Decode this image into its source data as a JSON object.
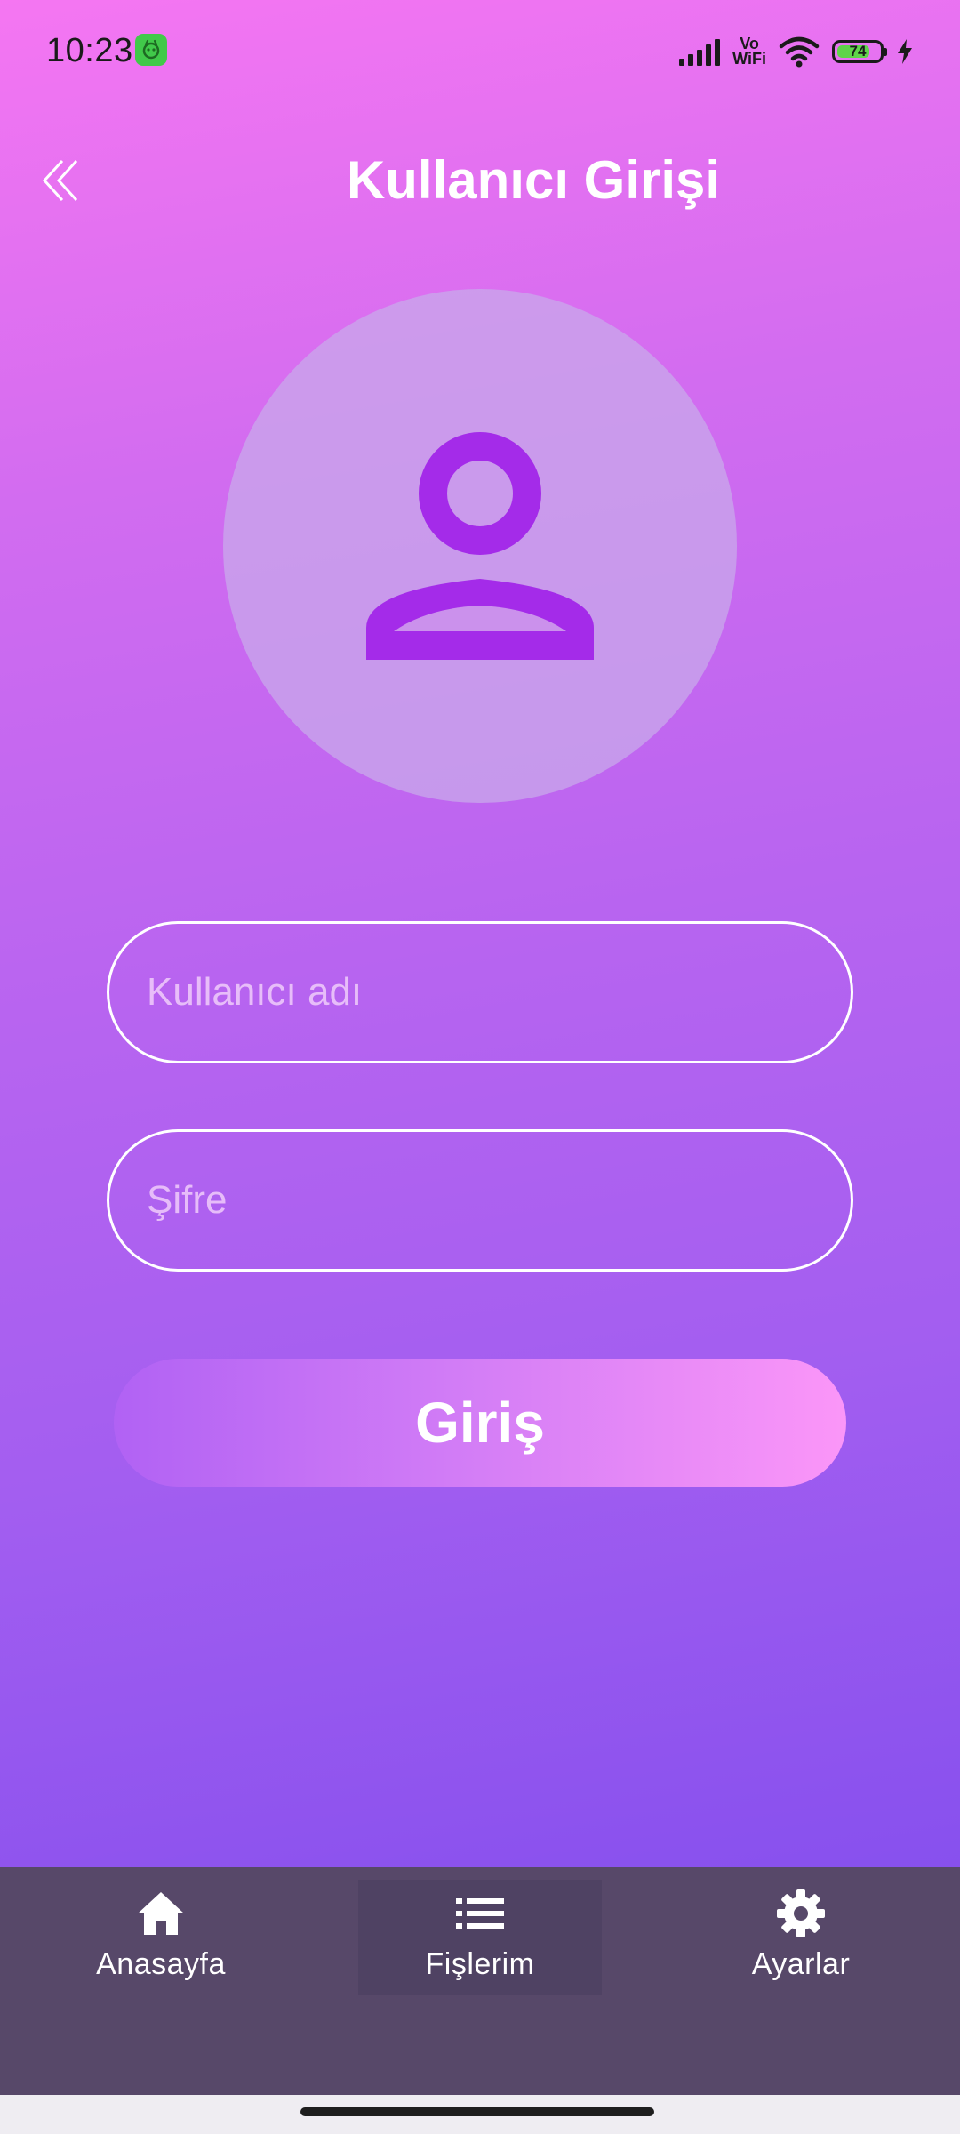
{
  "status_bar": {
    "time": "10:23",
    "network_label_top": "Vo",
    "network_label_bottom": "WiFi",
    "battery_level": "74",
    "icons": [
      "app-notification-icon",
      "signal-icon",
      "vowifi-icon",
      "wifi-icon",
      "battery-icon",
      "charging-icon"
    ]
  },
  "header": {
    "title": "Kullanıcı Girişi",
    "back_icon": "double-chevron-left-icon"
  },
  "avatar": {
    "icon": "person-outline-icon",
    "icon_color": "#a42be9"
  },
  "form": {
    "username_placeholder": "Kullanıcı adı",
    "username_value": "",
    "password_placeholder": "Şifre",
    "password_value": "",
    "login_label": "Giriş"
  },
  "bottom_nav": {
    "items": [
      {
        "label": "Anasayfa",
        "icon": "home-icon",
        "active": false
      },
      {
        "label": "Fişlerim",
        "icon": "list-icon",
        "active": true
      },
      {
        "label": "Ayarlar",
        "icon": "settings-icon",
        "active": false
      }
    ]
  },
  "colors": {
    "gradient_top": "#f576f2",
    "gradient_bottom": "#7b4bec",
    "nav_background": "#574869",
    "button_gradient_start": "#b162f4",
    "button_gradient_end": "#fb96f8"
  }
}
